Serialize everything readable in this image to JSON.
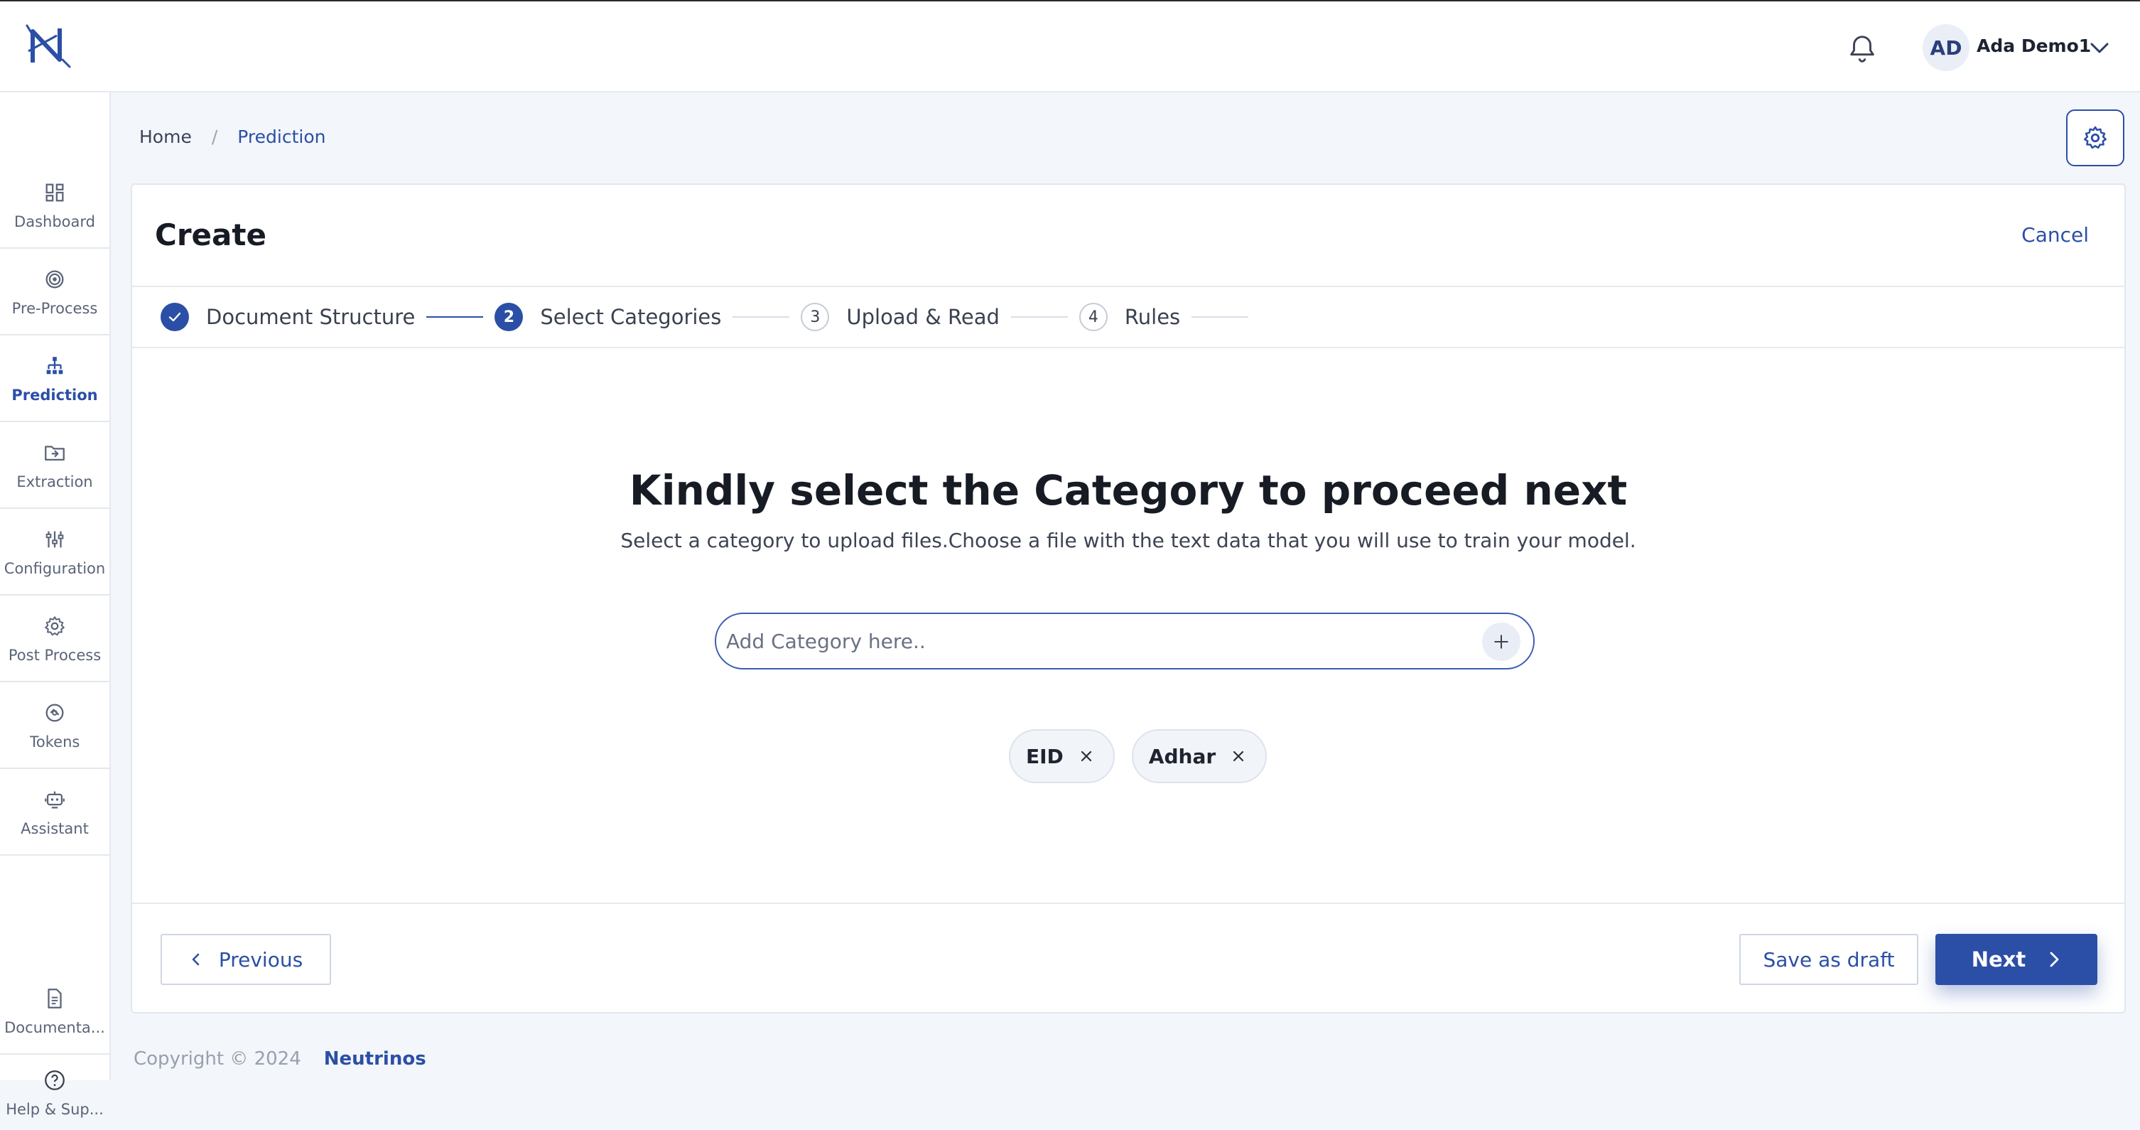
{
  "header": {
    "user_initials": "AD",
    "user_name": "Ada Demo1"
  },
  "sidebar": {
    "items": [
      {
        "label": "Dashboard",
        "icon": "dashboard-icon"
      },
      {
        "label": "Pre-Process",
        "icon": "target-icon"
      },
      {
        "label": "Prediction",
        "icon": "hierarchy-icon",
        "active": true
      },
      {
        "label": "Extraction",
        "icon": "folder-import-icon"
      },
      {
        "label": "Configuration",
        "icon": "sliders-icon"
      },
      {
        "label": "Post Process",
        "icon": "gear-icon"
      },
      {
        "label": "Tokens",
        "icon": "token-icon"
      },
      {
        "label": "Assistant",
        "icon": "robot-icon"
      }
    ],
    "bottom_items": [
      {
        "label": "Documenta...",
        "icon": "document-icon"
      },
      {
        "label": "Help & Sup...",
        "icon": "help-icon"
      }
    ]
  },
  "breadcrumb": {
    "home": "Home",
    "separator": "/",
    "current": "Prediction"
  },
  "card": {
    "title": "Create",
    "cancel_label": "Cancel"
  },
  "stepper": {
    "steps": [
      {
        "number": "1",
        "label": "Document Structure",
        "state": "done"
      },
      {
        "number": "2",
        "label": "Select Categories",
        "state": "current"
      },
      {
        "number": "3",
        "label": "Upload & Read",
        "state": "pending"
      },
      {
        "number": "4",
        "label": "Rules",
        "state": "pending"
      }
    ]
  },
  "main": {
    "heading": "Kindly select the Category to proceed next",
    "subheading": "Select a category to upload files.Choose a file with the text data that you will use to train your model.",
    "input_value": "",
    "input_placeholder": "Add Category here..",
    "categories": [
      "EID",
      "Adhar"
    ]
  },
  "actions": {
    "previous_label": "Previous",
    "draft_label": "Save as draft",
    "next_label": "Next"
  },
  "footer": {
    "copyright": "Copyright © 2024",
    "company": "Neutrinos"
  },
  "colors": {
    "accent": "#2b4fa6",
    "background": "#f3f6fa"
  }
}
